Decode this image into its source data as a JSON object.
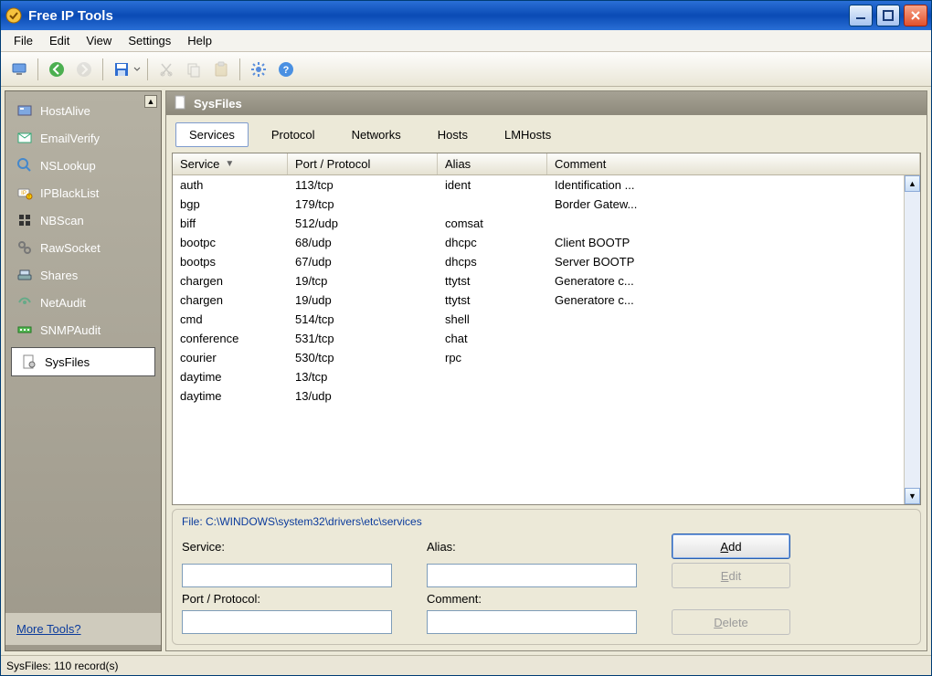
{
  "title": "Free IP Tools",
  "menu": [
    "File",
    "Edit",
    "View",
    "Settings",
    "Help"
  ],
  "sidebar": {
    "items": [
      {
        "label": "HostAlive",
        "icon": "host-icon"
      },
      {
        "label": "EmailVerify",
        "icon": "mail-icon"
      },
      {
        "label": "NSLookup",
        "icon": "lookup-icon"
      },
      {
        "label": "IPBlackList",
        "icon": "ipblack-icon"
      },
      {
        "label": "NBScan",
        "icon": "nbscan-icon"
      },
      {
        "label": "RawSocket",
        "icon": "socket-icon"
      },
      {
        "label": "Shares",
        "icon": "shares-icon"
      },
      {
        "label": "NetAudit",
        "icon": "audit-icon"
      },
      {
        "label": "SNMPAudit",
        "icon": "snmp-icon"
      },
      {
        "label": "SysFiles",
        "icon": "sysfiles-icon"
      }
    ],
    "selected_index": 9,
    "footer_link": "More Tools?"
  },
  "panel": {
    "title": "SysFiles",
    "tabs": [
      "Services",
      "Protocol",
      "Networks",
      "Hosts",
      "LMHosts"
    ],
    "active_tab": 0,
    "columns": [
      "Service",
      "Port / Protocol",
      "Alias",
      "Comment"
    ],
    "rows": [
      {
        "service": "auth",
        "port": "113/tcp",
        "alias": "ident",
        "comment": "Identification ..."
      },
      {
        "service": "bgp",
        "port": "179/tcp",
        "alias": "",
        "comment": "Border Gatew..."
      },
      {
        "service": "biff",
        "port": "512/udp",
        "alias": "comsat",
        "comment": ""
      },
      {
        "service": "bootpc",
        "port": "68/udp",
        "alias": "dhcpc",
        "comment": "Client BOOTP"
      },
      {
        "service": "bootps",
        "port": "67/udp",
        "alias": "dhcps",
        "comment": "Server BOOTP"
      },
      {
        "service": "chargen",
        "port": "19/tcp",
        "alias": "ttytst",
        "comment": "Generatore c..."
      },
      {
        "service": "chargen",
        "port": "19/udp",
        "alias": "ttytst",
        "comment": "Generatore c..."
      },
      {
        "service": "cmd",
        "port": "514/tcp",
        "alias": "shell",
        "comment": ""
      },
      {
        "service": "conference",
        "port": "531/tcp",
        "alias": "chat",
        "comment": ""
      },
      {
        "service": "courier",
        "port": "530/tcp",
        "alias": "rpc",
        "comment": ""
      },
      {
        "service": "daytime",
        "port": "13/tcp",
        "alias": "",
        "comment": ""
      },
      {
        "service": "daytime",
        "port": "13/udp",
        "alias": "",
        "comment": ""
      }
    ]
  },
  "form": {
    "file_label_prefix": "File: ",
    "file_path": "C:\\WINDOWS\\system32\\drivers\\etc\\services",
    "service_label": "Service:",
    "alias_label": "Alias:",
    "port_label": "Port / Protocol:",
    "comment_label": "Comment:",
    "service_value": "",
    "alias_value": "",
    "port_value": "",
    "comment_value": "",
    "add_label": "Add",
    "edit_label": "Edit",
    "delete_label": "Delete"
  },
  "status": "SysFiles: 110 record(s)"
}
